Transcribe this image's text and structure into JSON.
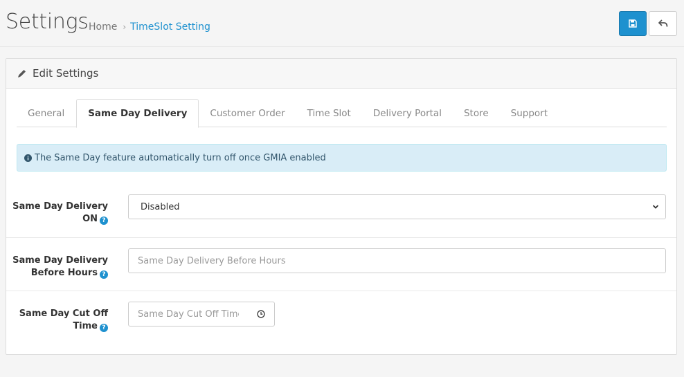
{
  "header": {
    "title": "Settings",
    "breadcrumb": {
      "home": "Home",
      "separator": "›",
      "current": "TimeSlot Setting"
    },
    "save_icon": "floppy-disk-icon",
    "back_icon": "reply-arrow-icon"
  },
  "panel": {
    "heading": "Edit Settings",
    "heading_icon": "pencil-icon"
  },
  "tabs": [
    {
      "label": "General",
      "active": false
    },
    {
      "label": "Same Day Delivery",
      "active": true
    },
    {
      "label": "Customer Order",
      "active": false
    },
    {
      "label": "Time Slot",
      "active": false
    },
    {
      "label": "Delivery Portal",
      "active": false
    },
    {
      "label": "Store",
      "active": false
    },
    {
      "label": "Support",
      "active": false
    }
  ],
  "alert": {
    "icon": "info-circle-icon",
    "text": "The Same Day feature automatically turn off once GMIA enabled"
  },
  "fields": {
    "sdd_on": {
      "label_line1": "Same Day Delivery",
      "label_line2": "ON",
      "value": "Disabled"
    },
    "sdd_before_hours": {
      "label_line1": "Same Day Delivery",
      "label_line2": "Before Hours",
      "placeholder": "Same Day Delivery Before Hours"
    },
    "sdd_cutoff": {
      "label_line1": "Same Day Cut Off",
      "label_line2": "Time",
      "placeholder": "Same Day Cut Off Time"
    }
  },
  "colors": {
    "primary": "#1e91cf",
    "alert_bg": "#d9edf7",
    "page_bg": "#f5f5f5"
  }
}
